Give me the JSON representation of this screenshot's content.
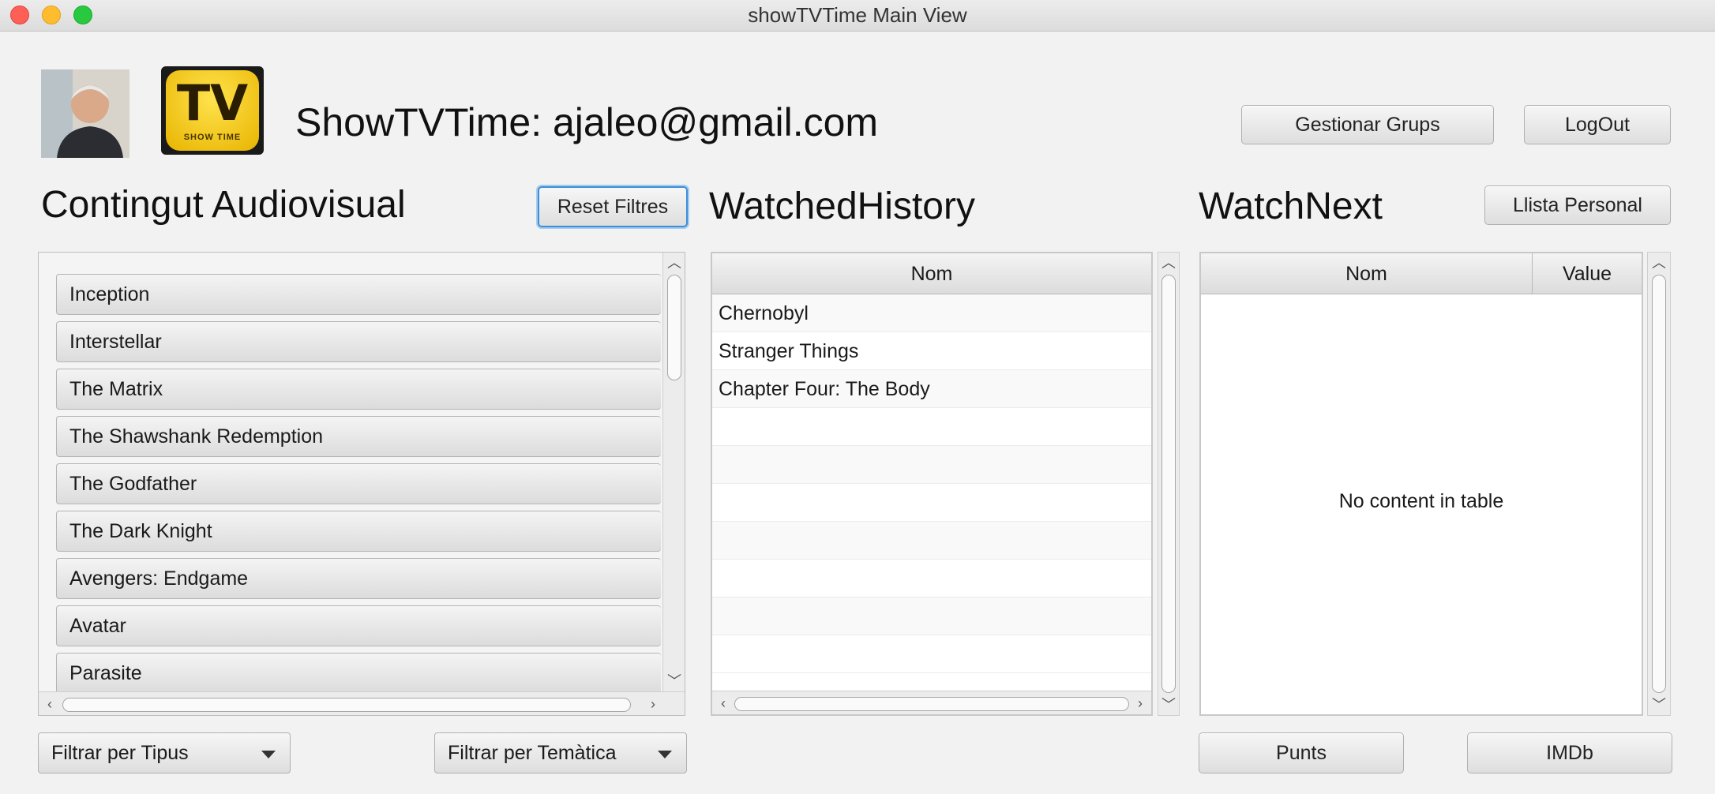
{
  "window": {
    "title": "showTVTime Main View"
  },
  "header": {
    "title": "ShowTVTime: ajaleo@gmail.com",
    "logo_text": "SHOW TIME"
  },
  "buttons": {
    "groups": "Gestionar Grups",
    "logout": "LogOut",
    "reset_filters": "Reset Filtres",
    "personal_list": "Llista Personal",
    "points": "Punts",
    "imdb": "IMDb"
  },
  "content": {
    "title": "Contingut Audiovisual",
    "items": [
      "Inception",
      "Interstellar",
      "The Matrix",
      "The Shawshank Redemption",
      "The Godfather",
      "The Dark Knight",
      "Avengers: Endgame",
      "Avatar",
      "Parasite"
    ]
  },
  "history": {
    "title": "WatchedHistory",
    "column": "Nom",
    "rows": [
      "Chernobyl",
      "Stranger Things",
      "Chapter Four: The Body"
    ]
  },
  "watch_next": {
    "title": "WatchNext",
    "columns": [
      "Nom",
      "Value"
    ],
    "empty_text": "No content in table"
  },
  "filters": {
    "type": "Filtrar per Tipus",
    "theme": "Filtrar per Temàtica"
  }
}
